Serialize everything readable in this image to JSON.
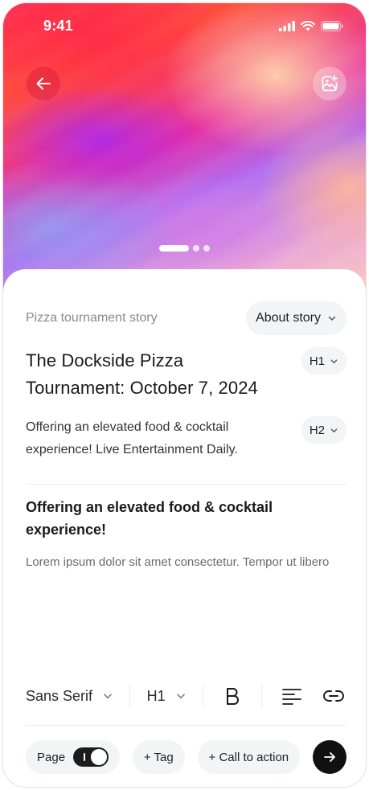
{
  "status_bar": {
    "time": "9:41",
    "signal_icon": "cellular-signal-icon",
    "wifi_icon": "wifi-icon",
    "battery_icon": "battery-icon"
  },
  "hero": {
    "back_icon": "arrow-left-icon",
    "image_icon": "image-add-icon",
    "pager": {
      "count": 3,
      "active_index": 0
    }
  },
  "meta": {
    "label": "Pizza tournament story",
    "category_button": "About story"
  },
  "title": {
    "text": "The Dockside Pizza Tournament: October 7, 2024",
    "level": "H1"
  },
  "subtitle": {
    "text": "Offering an elevated food & cocktail experience!  Live Entertainment Daily.",
    "level": "H2"
  },
  "body": {
    "heading": "Offering an elevated food & cocktail experience!",
    "text": "Lorem ipsum dolor sit amet consectetur. Tempor ut libero"
  },
  "toolbar": {
    "font": "Sans Serif",
    "heading": "H1",
    "bold_icon": "bold-icon",
    "align_icon": "align-left-icon",
    "link_icon": "link-icon"
  },
  "actions": {
    "page_label": "Page",
    "page_toggle_on": true,
    "tag_label": "+ Tag",
    "cta_label": "+ Call to action",
    "send_icon": "arrow-right-icon"
  },
  "colors": {
    "accent": "#111111",
    "pill_bg": "#f3f4f5",
    "muted_text": "#8a8a8a"
  }
}
